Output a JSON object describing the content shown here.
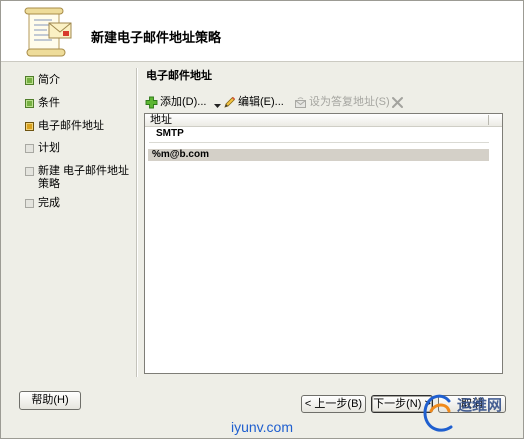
{
  "window": {
    "title": "新建电子邮件地址策略"
  },
  "header": {
    "icon": "email-address-policy-icon"
  },
  "steps": [
    {
      "label": "简介",
      "icon": "step-complete-icon"
    },
    {
      "label": "条件",
      "icon": "step-complete-icon"
    },
    {
      "label": "电子邮件地址",
      "icon": "step-current-icon"
    },
    {
      "label": "计划",
      "icon": "step-pending-icon"
    },
    {
      "label": "新建 电子邮件地址\n策略",
      "icon": "step-pending-icon"
    },
    {
      "label": "完成",
      "icon": "step-pending-icon"
    }
  ],
  "content": {
    "heading": "电子邮件地址",
    "toolbar": {
      "add": {
        "label": "添加(D)...",
        "icon": "plus-icon",
        "enabled": true
      },
      "add_menu": {
        "icon": "dropdown-arrow-icon",
        "enabled": true
      },
      "edit": {
        "label": "编辑(E)...",
        "icon": "pencil-icon",
        "enabled": true
      },
      "set_reply": {
        "label": "设为答复地址(S)",
        "icon": "envelope-reply-icon",
        "enabled": false
      },
      "remove": {
        "icon": "delete-x-icon",
        "enabled": false
      }
    },
    "list": {
      "columns": [
        "地址"
      ],
      "groups": [
        {
          "name": "SMTP",
          "rows": [
            {
              "address": "%m@b.com",
              "selected": true
            }
          ]
        }
      ]
    }
  },
  "buttons": {
    "help": "帮助(H)",
    "back": "< 上一步(B)",
    "next": "下一步(N) >",
    "cancel": "取消"
  },
  "watermark": {
    "brand": "运维网",
    "site": "iyunv.com",
    "icon": "iyunv-logo-icon"
  },
  "colors": {
    "step_complete": "#76B043",
    "step_current": "#D9A21E",
    "step_pending": "#E4E4DE",
    "selection": "#D4D0C8",
    "disabled_text": "#A5A5A0",
    "watermark_blue": "#1F5FCF",
    "watermark_orange": "#F08A1C"
  }
}
